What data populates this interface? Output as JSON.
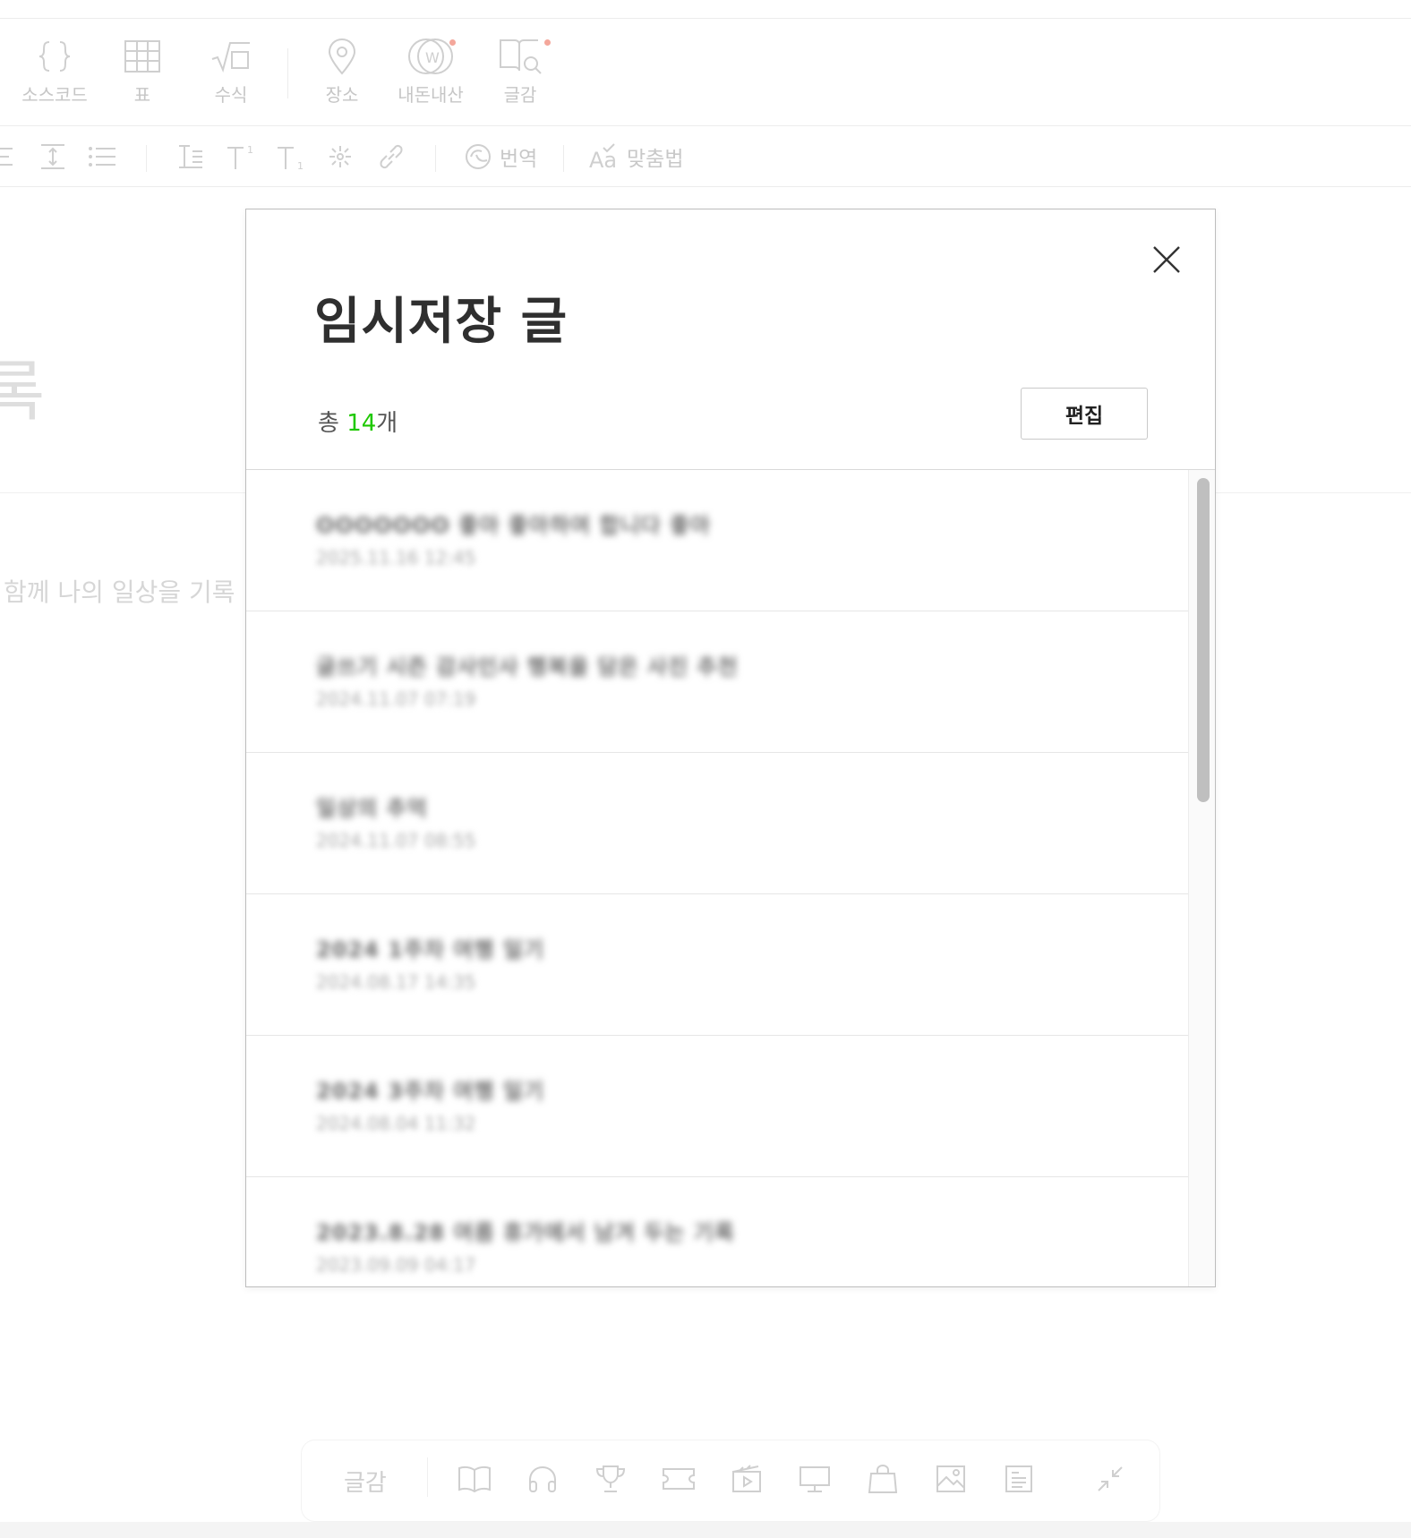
{
  "toolbar_row1": [
    {
      "name": "source-code",
      "label": "소스코드"
    },
    {
      "name": "table",
      "label": "표"
    },
    {
      "name": "formula",
      "label": "수식"
    },
    {
      "name": "place",
      "label": "장소"
    },
    {
      "name": "naedonnaesan",
      "label": "내돈내산"
    },
    {
      "name": "geulgam",
      "label": "글감"
    }
  ],
  "toolbar_row2": {
    "translate_label": "번역",
    "spellcheck_label": "맞춤법"
  },
  "background": {
    "title_fragment": "록",
    "placeholder_fragment": "함께 나의 일상을 기록"
  },
  "modal": {
    "title": "임시저장 글",
    "count_prefix": "총 ",
    "count_value": "14",
    "count_suffix": "개",
    "edit_label": "편집",
    "accent_color": "#1ec800",
    "items": [
      {
        "title": "OOOOOOO 좋아 좋아하여 합니다 좋아",
        "date": "2025.11.16 12:45"
      },
      {
        "title": "글쓰기 시즌 감사인사 행복을 담은 사진 추천",
        "date": "2024.11.07 07:19"
      },
      {
        "title": "일상의 추억",
        "date": "2024.11.07 08:55"
      },
      {
        "title": "2024 1주차 여행 일기",
        "date": "2024.08.17 14:35"
      },
      {
        "title": "2024 3주차 여행 일기",
        "date": "2024.08.04 11:32"
      },
      {
        "title": "2023.8.28 여름 휴가에서 남겨 두는 기록",
        "date": "2023.09.09 04:17"
      }
    ]
  },
  "bottom_toolbar": {
    "label": "글감",
    "icons": [
      "book-icon",
      "headphones-icon",
      "trophy-icon",
      "ticket-icon",
      "movie-icon",
      "tv-icon",
      "shopping-bag-icon",
      "image-icon",
      "news-icon"
    ]
  }
}
